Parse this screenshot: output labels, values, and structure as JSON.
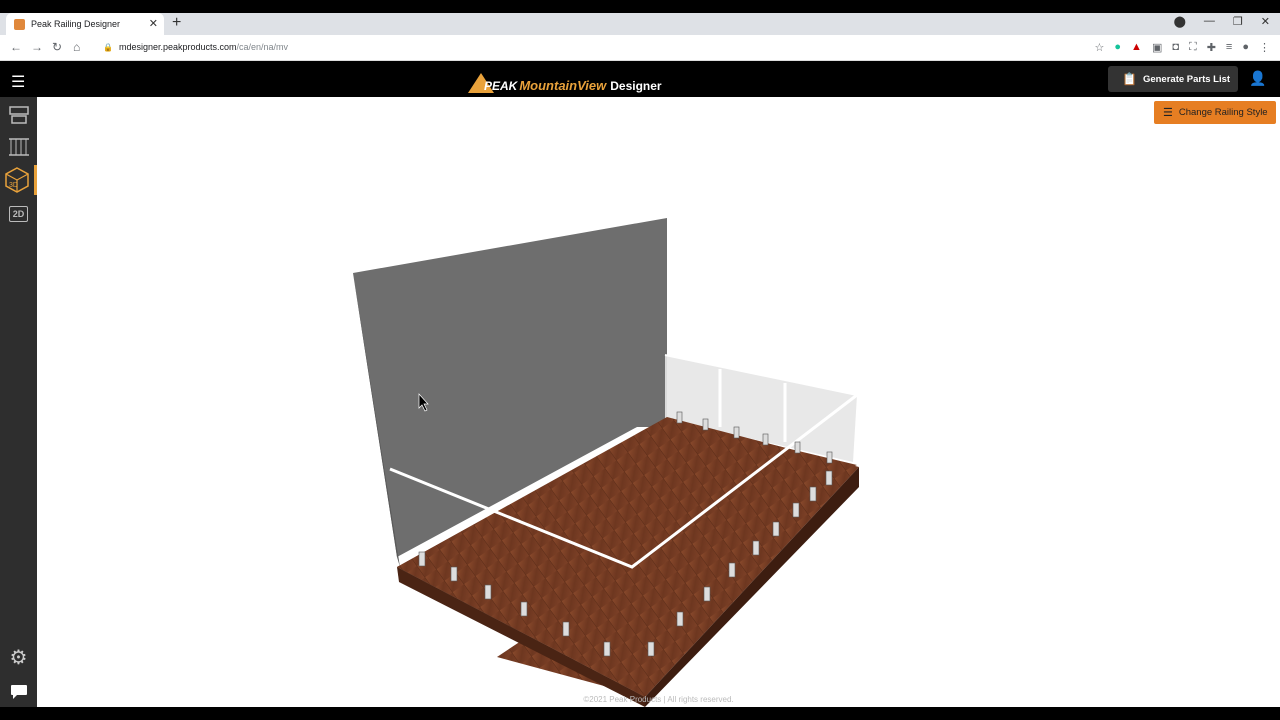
{
  "browser": {
    "tab_title": "Peak Railing Designer",
    "tab_close": "✕",
    "new_tab": "+",
    "url_host": "mdesigner.peakproducts.com",
    "url_path": "/ca/en/na/mv",
    "window_controls": [
      "—",
      "❐",
      "✕"
    ]
  },
  "header": {
    "logo_peak": "PEAK",
    "logo_mountainview": "MountainView",
    "logo_designer": "Designer",
    "generate_button": "Generate Parts List"
  },
  "sidebar": {
    "items": [
      {
        "icon": "deck-plan-icon"
      },
      {
        "icon": "railing-icon"
      },
      {
        "icon": "3d-view-icon",
        "active": true,
        "label": "3D"
      },
      {
        "icon": "2d-view-icon",
        "label": "2D"
      }
    ],
    "settings_icon": "gear-icon",
    "chat_icon": "chat-icon"
  },
  "canvas": {
    "change_style_button": "Change Railing Style",
    "footer": "©2021 Peak Products | All rights reserved."
  },
  "colors": {
    "accent": "#e67e22",
    "logo_orange": "#e9a23b",
    "header_bg": "#000000",
    "sidebar_bg": "#2e2e2e",
    "wall": "#6e6e6e",
    "deck": "#7a3e24"
  }
}
